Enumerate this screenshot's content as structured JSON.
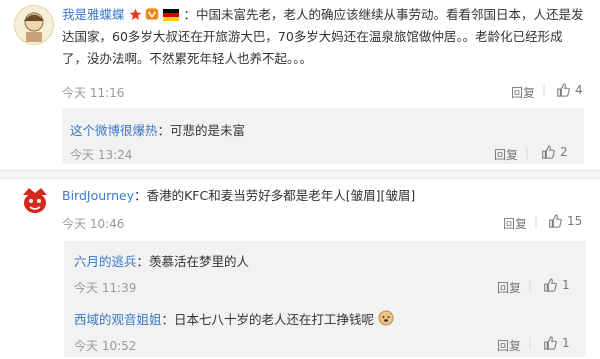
{
  "comments": [
    {
      "username": "我是雅蝶蝶",
      "text": "：中国未富先老，老人的确应该继续从事劳动。看看邻国日本，人还是发达国家，60多岁大叔还在开旅游大巴，70多岁大妈还在温泉旅馆做仲居。。老龄化已经形成了，没办法啊。不然累死年轻人也养不起。。。",
      "time": "今天 11:16",
      "reply_label": "回复",
      "like_count": "4",
      "badges": [
        "star-icon",
        "vip-icon",
        "germany-flag-icon"
      ],
      "replies": [
        {
          "username": "这个微博很爆热",
          "text": "：可悲的是未富",
          "time": "今天 13:24",
          "reply_label": "回复",
          "like_count": "2"
        }
      ]
    },
    {
      "username": "BirdJourney",
      "text": "：香港的KFC和麦当劳好多都是老年人[皱眉][皱眉]",
      "time": "今天 10:46",
      "reply_label": "回复",
      "like_count": "15",
      "replies": [
        {
          "username": "六月的逃兵",
          "text": "：羡慕活在梦里的人",
          "time": "今天 11:39",
          "reply_label": "回复",
          "like_count": "1"
        },
        {
          "username": "西域的观音姐姐",
          "text": "：日本七八十岁的老人还在打工挣钱呢",
          "time": "今天 10:52",
          "reply_label": "回复",
          "like_count": "1"
        }
      ]
    }
  ],
  "colors": {
    "link": "#3a79c9",
    "meta": "#999999",
    "sub_bg": "#f2f2f2"
  }
}
